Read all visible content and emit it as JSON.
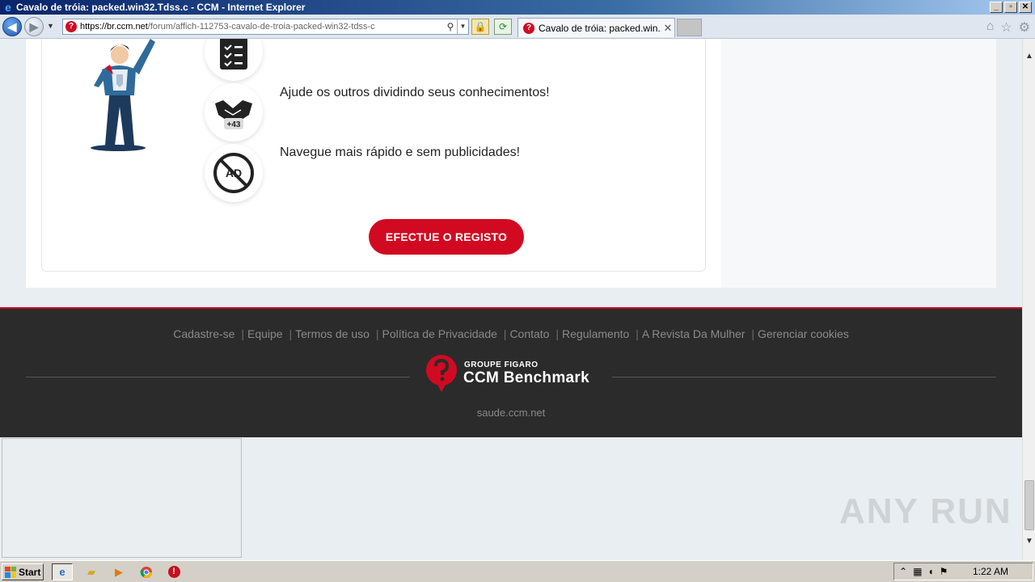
{
  "window": {
    "title": "Cavalo de tróia: packed.win32.Tdss.c - CCM - Internet Explorer",
    "controls": {
      "minimize": "_",
      "maximize": "▫",
      "close": "✕"
    }
  },
  "browser": {
    "url_host": "https://br.ccm.net",
    "url_path": "/forum/affich-112753-cavalo-de-troia-packed-win32-tdss-c",
    "tab_label": "Cavalo de tróia: packed.win...",
    "tab_close": "✕"
  },
  "page": {
    "features": [
      {
        "icon": "clipboard-checklist-icon",
        "text": ""
      },
      {
        "icon": "handshake-icon",
        "badge": "+43",
        "text": "Ajude os outros dividindo seus conhecimentos!"
      },
      {
        "icon": "no-ads-icon",
        "badge": "AD",
        "text": "Navegue mais rápido e sem publicidades!"
      }
    ],
    "cta_label": "EFECTUE O REGISTO"
  },
  "footer": {
    "links": [
      "Cadastre-se",
      "Equipe",
      "Termos de uso",
      "Política de Privacidade",
      "Contato",
      "Regulamento",
      "A Revista Da Mulher",
      "Gerenciar cookies"
    ],
    "brand_top": "GROUPE FIGARO",
    "brand_name": "CCM Benchmark",
    "domain": "saude.ccm.net"
  },
  "watermark": "ANY RUN",
  "taskbar": {
    "start_label": "Start",
    "time": "1:22 AM"
  },
  "colors": {
    "brand_red": "#d10a22",
    "footer_bg": "#2b2b2b"
  }
}
